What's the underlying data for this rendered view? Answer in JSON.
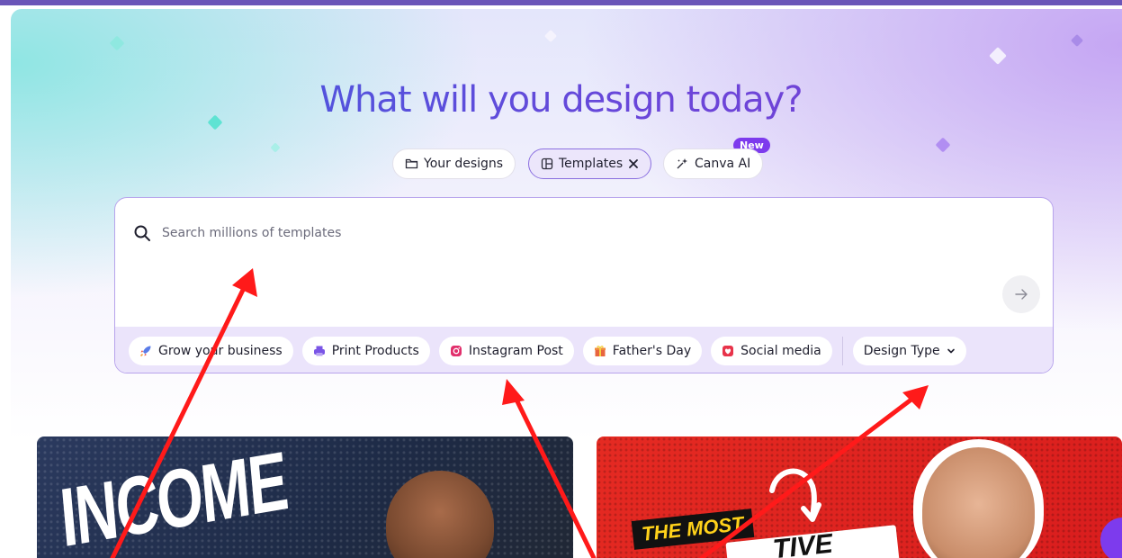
{
  "hero": {
    "title": "What will you design today?",
    "new_badge": "New",
    "tabs": [
      {
        "label": "Your designs",
        "icon": "folder-icon"
      },
      {
        "label": "Templates",
        "icon": "templates-icon",
        "active": true,
        "closable": true
      },
      {
        "label": "Canva AI",
        "icon": "sparkle-wand-icon"
      }
    ]
  },
  "search": {
    "placeholder": "Search millions of templates",
    "value": ""
  },
  "chips": [
    {
      "label": "Grow your business",
      "icon": "rocket-icon"
    },
    {
      "label": "Print Products",
      "icon": "printer-icon"
    },
    {
      "label": "Instagram Post",
      "icon": "instagram-icon"
    },
    {
      "label": "Father's Day",
      "icon": "gift-icon"
    },
    {
      "label": "Social media",
      "icon": "heart-icon"
    }
  ],
  "design_type_dropdown": {
    "label": "Design Type"
  },
  "cards": {
    "card1_text": "INCOME",
    "card2_label": "THE MOST",
    "card2_text": "TIVE"
  },
  "colors": {
    "accent": "#7d3bed",
    "title_gradient_start": "#3d5fe0",
    "title_gradient_end": "#7a3fd1",
    "annotation_arrow": "#ff0000"
  }
}
